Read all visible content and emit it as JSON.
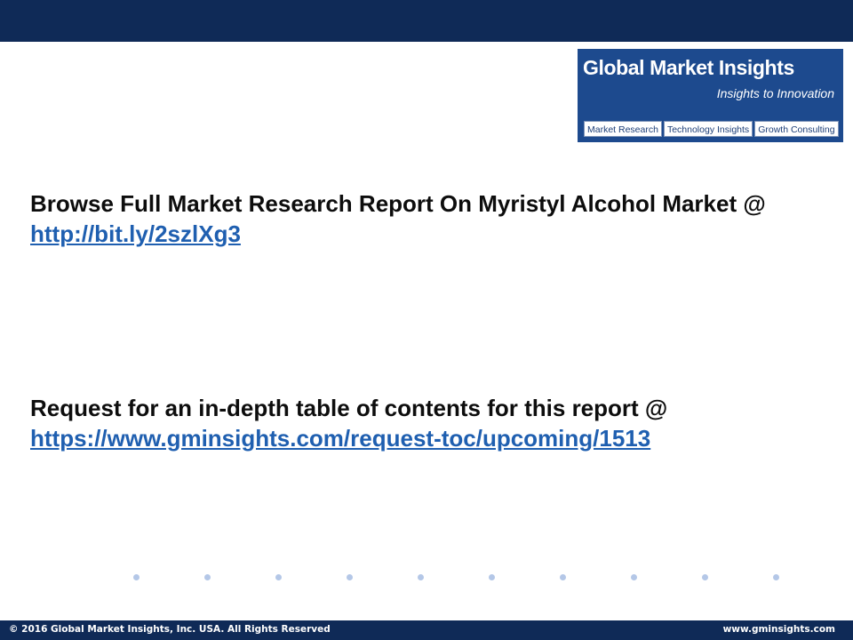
{
  "logo": {
    "title": "Global Market Insights",
    "tagline": "Insights to Innovation",
    "tabs": [
      "Market Research",
      "Technology Insights",
      "Growth Consulting"
    ]
  },
  "content": {
    "block1_text": "Browse Full Market Research Report On Myristyl Alcohol Market @ ",
    "block1_link": "http://bit.ly/2szlXg3",
    "block2_text": "Request for an in-depth table of contents for this report @ ",
    "block2_link": "https://www.gminsights.com/request-toc/upcoming/1513"
  },
  "footer": {
    "copyright": "© 2016 Global Market Insights, Inc. USA.  All Rights Reserved",
    "website": "www.gminsights.com"
  },
  "colors": {
    "header_bar": "#0f2a57",
    "logo_background": "#1d4a8e",
    "link": "#1f5fb0",
    "dot": "#b4c7e7"
  }
}
